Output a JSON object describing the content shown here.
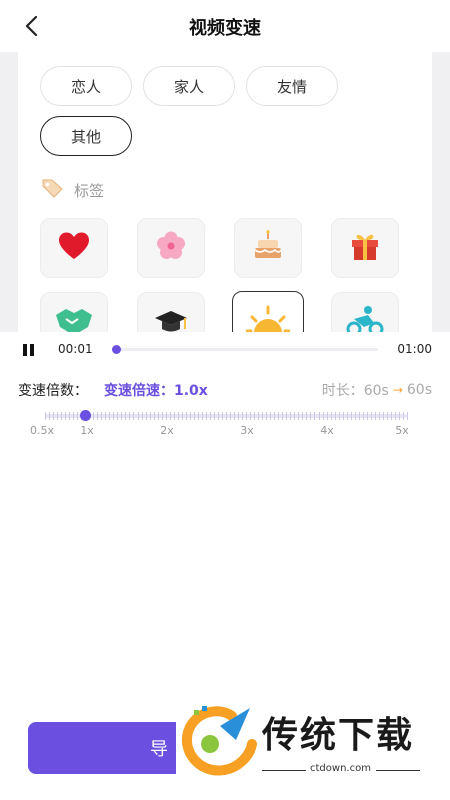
{
  "header": {
    "title": "视频变速",
    "back_icon": "chevron-left-icon"
  },
  "categories": {
    "chips": [
      {
        "label": "恋人",
        "active": false
      },
      {
        "label": "家人",
        "active": false
      },
      {
        "label": "友情",
        "active": false
      },
      {
        "label": "其他",
        "active": true
      }
    ],
    "tag_label": "标签",
    "tag_icon": "tag-icon"
  },
  "stickers": [
    {
      "icon": "heart-icon",
      "active": false
    },
    {
      "icon": "flower-icon",
      "active": false
    },
    {
      "icon": "cake-icon",
      "active": false
    },
    {
      "icon": "gift-icon",
      "active": false
    },
    {
      "icon": "handshake-icon",
      "active": false
    },
    {
      "icon": "graduation-cap-icon",
      "active": false
    },
    {
      "icon": "sunrise-icon",
      "active": true
    },
    {
      "icon": "cyclist-icon",
      "active": false
    }
  ],
  "player": {
    "state_icon": "pause-icon",
    "current_time": "00:01",
    "total_time": "01:00",
    "progress": 0.0
  },
  "speed": {
    "label": "变速倍数：",
    "value_text": "变速倍速：1.0x",
    "duration_label": "时长：60s",
    "duration_new": "60s",
    "value": 1.0,
    "marks": [
      "0.5x",
      "1x",
      "2x",
      "3x",
      "4x",
      "5x"
    ]
  },
  "export": {
    "label": "导"
  },
  "watermark": {
    "brand": "传统下载",
    "url": "ctdown.com"
  },
  "colors": {
    "accent": "#6b4fe0",
    "arrow": "#f5a531"
  }
}
